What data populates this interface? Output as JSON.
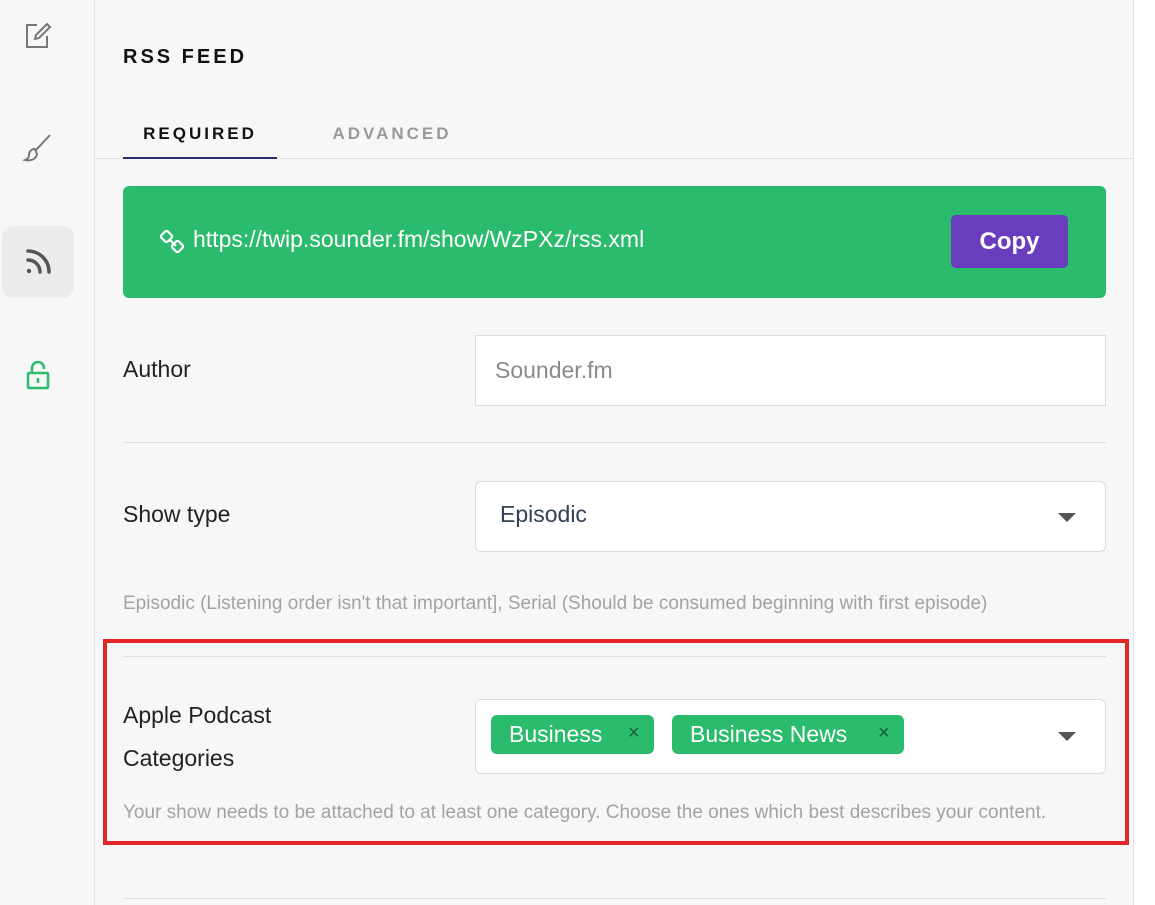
{
  "sidebar": {
    "items": [
      {
        "icon": "edit-icon"
      },
      {
        "icon": "brush-icon"
      },
      {
        "icon": "rss-icon",
        "active": true
      },
      {
        "icon": "unlock-icon",
        "color": "#2bbb6c"
      }
    ]
  },
  "page": {
    "title": "RSS FEED"
  },
  "tabs": [
    {
      "label": "REQUIRED",
      "active": true
    },
    {
      "label": "ADVANCED",
      "active": false
    }
  ],
  "rss": {
    "url": "https://twip.sounder.fm/show/WzPXz/rss.xml",
    "copy_label": "Copy",
    "icon": "link-icon"
  },
  "author": {
    "label": "Author",
    "value": "",
    "placeholder": "Sounder.fm"
  },
  "show_type": {
    "label": "Show type",
    "value": "Episodic",
    "help": "Episodic (Listening order isn't that important], Serial (Should be consumed beginning with first episode)"
  },
  "categories": {
    "label_line1": "Apple Podcast",
    "label_line2": "Categories",
    "selected": [
      {
        "label": "Business",
        "remove": "×"
      },
      {
        "label": "Business News",
        "remove": "×"
      }
    ],
    "help": "Your show needs to be attached to at least one category. Choose the ones which best describes your content."
  },
  "colors": {
    "accent_green": "#2bbb6c",
    "button_purple": "#6a3dbf",
    "highlight_red": "#e3262a",
    "tab_underline": "#2c2f6f"
  }
}
